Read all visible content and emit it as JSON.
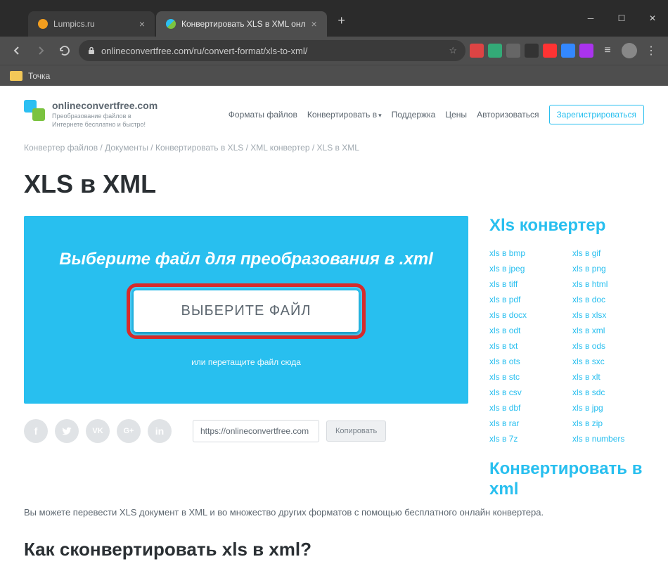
{
  "window": {
    "tabs": [
      {
        "title": "Lumpics.ru",
        "active": false
      },
      {
        "title": "Конвертировать XLS в XML онл",
        "active": true
      }
    ]
  },
  "omnibox": {
    "url": "onlineconvertfree.com/ru/convert-format/xls-to-xml/"
  },
  "bookmarks": {
    "item1": "Точка"
  },
  "header": {
    "logo_title": "onlineconvertfree.com",
    "logo_sub": "Преобразование файлов в Интернете бесплатно и быстро!",
    "nav": {
      "formats": "Форматы файлов",
      "convert": "Конвертировать в",
      "support": "Поддержка",
      "prices": "Цены",
      "login": "Авторизоваться",
      "register": "Зарегистрироваться"
    }
  },
  "breadcrumb": "Конвертер файлов / Документы / Конвертировать в XLS / XML конвертер / XLS в XML",
  "page": {
    "h1": "XLS в XML",
    "box_title": "Выберите файл для преобразования в .xml",
    "choose_button": "ВЫБЕРИТЕ ФАЙЛ",
    "drag_hint": "или перетащите файл сюда",
    "url_value": "https://onlineconvertfree.com",
    "copy_label": "Копировать",
    "paragraph": "Вы можете перевести XLS документ в XML и во множество других форматов с помощью бесплатного онлайн конвертера.",
    "h2": "Как сконвертировать xls в xml?"
  },
  "sidebar": {
    "h1": "Xls конвертер",
    "links_col1": [
      "xls в bmp",
      "xls в jpeg",
      "xls в tiff",
      "xls в pdf",
      "xls в docx",
      "xls в odt",
      "xls в txt",
      "xls в ots",
      "xls в stc",
      "xls в csv",
      "xls в dbf",
      "xls в rar",
      "xls в 7z"
    ],
    "links_col2": [
      "xls в gif",
      "xls в png",
      "xls в html",
      "xls в doc",
      "xls в xlsx",
      "xls в xml",
      "xls в ods",
      "xls в sxc",
      "xls в xlt",
      "xls в sdc",
      "xls в jpg",
      "xls в zip",
      "xls в numbers"
    ],
    "h2": "Конвертировать в xml"
  }
}
